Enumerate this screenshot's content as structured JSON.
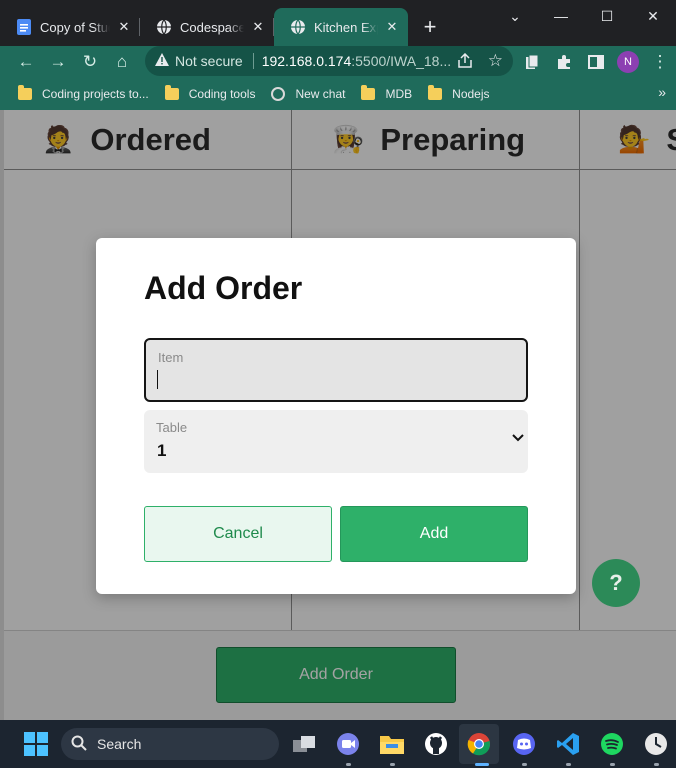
{
  "browser": {
    "tabs": [
      {
        "title": "Copy of Student",
        "icon": "docs-icon",
        "active": false
      },
      {
        "title": "Codespace LMS",
        "icon": "globe-icon",
        "active": false
      },
      {
        "title": "Kitchen Express",
        "icon": "globe-icon",
        "active": true
      }
    ],
    "security_label": "Not secure",
    "url_host": "192.168.0.174",
    "url_rest": ":5500/IWA_18...",
    "profile_initial": "N",
    "bookmarks": [
      {
        "label": "Coding projects to...",
        "icon": "folder-icon"
      },
      {
        "label": "Coding tools",
        "icon": "folder-icon"
      },
      {
        "label": "New chat",
        "icon": "chatgpt-icon"
      },
      {
        "label": "MDB",
        "icon": "folder-icon"
      },
      {
        "label": "Nodejs",
        "icon": "folder-icon"
      }
    ]
  },
  "board": {
    "columns": [
      {
        "emoji": "🤵",
        "title": "Ordered"
      },
      {
        "emoji": "👩‍🍳",
        "title": "Preparing"
      },
      {
        "emoji": "💁",
        "title": "Served"
      }
    ],
    "add_order_label": "Add Order",
    "help_label": "?"
  },
  "modal": {
    "title": "Add Order",
    "item_label": "Item",
    "item_value": "",
    "table_label": "Table",
    "table_value": "1",
    "cancel_label": "Cancel",
    "add_label": "Add"
  },
  "taskbar": {
    "search_label": "Search"
  },
  "colors": {
    "browser_theme": "#1f6b5b",
    "primary_green": "#2eb069",
    "help_green": "#2c8a58"
  }
}
